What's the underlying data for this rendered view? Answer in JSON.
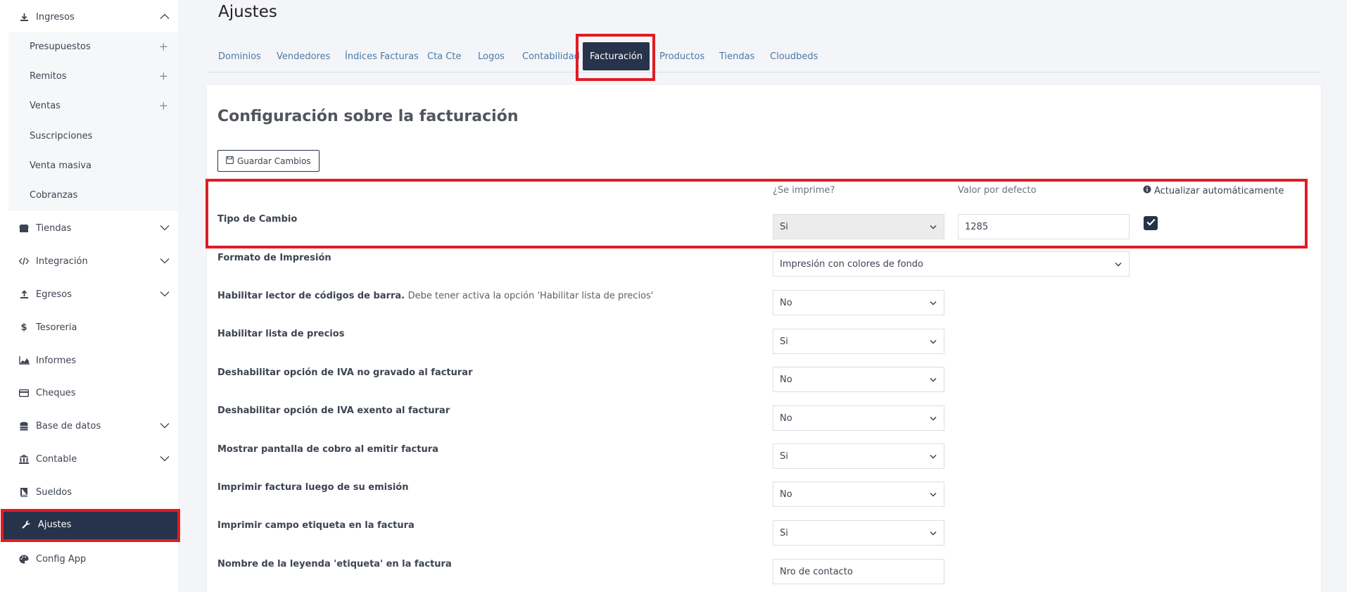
{
  "sidebar": {
    "ingresos": "Ingresos",
    "sub": [
      {
        "label": "Presupuestos",
        "plus": "+"
      },
      {
        "label": "Remitos",
        "plus": "+"
      },
      {
        "label": "Ventas",
        "plus": "+"
      },
      {
        "label": "Suscripciones"
      },
      {
        "label": "Venta masiva"
      },
      {
        "label": "Cobranzas"
      }
    ],
    "items": [
      {
        "label": "Tiendas",
        "icon": "store-icon"
      },
      {
        "label": "Integración",
        "icon": "code-icon"
      },
      {
        "label": "Egresos",
        "icon": "upload-icon"
      },
      {
        "label": "Tesoreria",
        "icon": "dollar-icon"
      },
      {
        "label": "Informes",
        "icon": "chart-icon"
      },
      {
        "label": "Cheques",
        "icon": "card-icon"
      },
      {
        "label": "Base de datos",
        "icon": "database-icon"
      },
      {
        "label": "Contable",
        "icon": "bank-icon"
      },
      {
        "label": "Sueldos",
        "icon": "book-icon"
      },
      {
        "label": "Ajustes",
        "icon": "wrench-icon"
      },
      {
        "label": "Config App",
        "icon": "palette-icon"
      }
    ]
  },
  "header": {
    "title": "Ajustes"
  },
  "tabs": [
    "Dominios",
    "Vendedores",
    "Índices Facturas",
    "Cta Cte",
    "Logos",
    "Contabilidad",
    "Facturación",
    "Productos",
    "Tiendas",
    "Cloudbeds"
  ],
  "card": {
    "title": "Configuración sobre la facturación",
    "save_label": "Guardar Cambios",
    "col_print": "¿Se imprime?",
    "col_default": "Valor por defecto",
    "col_auto": "Actualizar automáticamente"
  },
  "rows": {
    "tipo_cambio": {
      "label": "Tipo de Cambio",
      "print": "Si",
      "default": "1285",
      "auto": true
    },
    "formato": {
      "label": "Formato de Impresión",
      "value": "Impresión con colores de fondo"
    },
    "lector": {
      "label": "Habilitar lector de códigos de barra.",
      "note": "Debe tener activa la opción 'Habilitar lista de precios'",
      "value": "No"
    },
    "lista": {
      "label": "Habilitar lista de precios",
      "value": "Si"
    },
    "iva_no_gravado": {
      "label": "Deshabilitar opción de IVA no gravado al facturar",
      "value": "No"
    },
    "iva_exento": {
      "label": "Deshabilitar opción de IVA exento al facturar",
      "value": "No"
    },
    "pantalla_cobro": {
      "label": "Mostrar pantalla de cobro al emitir factura",
      "value": "Si"
    },
    "imprimir_factura": {
      "label": "Imprimir factura luego de su emisión",
      "value": "No"
    },
    "campo_etiqueta": {
      "label": "Imprimir campo etiqueta en la factura",
      "value": "Si"
    },
    "leyenda": {
      "label": "Nombre de la leyenda 'etiqueta' en la factura",
      "value": "Nro de contacto"
    }
  },
  "colors": {
    "accent": "#27334a",
    "highlight": "#e01c24",
    "link": "#4a7aa8"
  }
}
